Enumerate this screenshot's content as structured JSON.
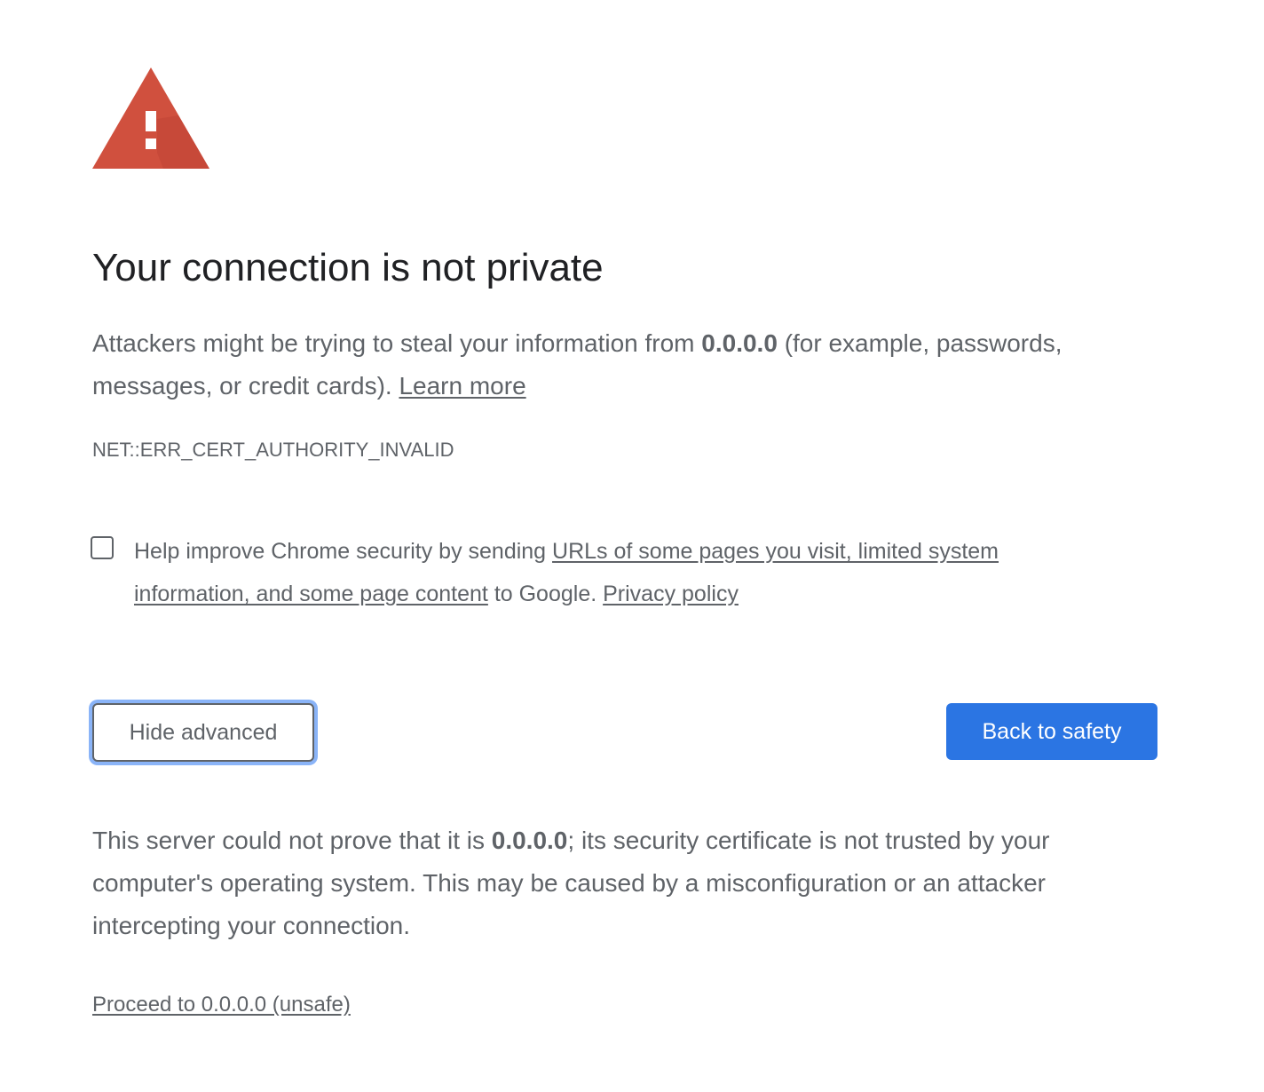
{
  "heading": {
    "title": "Your connection is not private"
  },
  "main_message": {
    "prefix": "Attackers might be trying to steal your information from ",
    "host": "0.0.0.0",
    "suffix": " (for example, passwords, messages, or credit cards). ",
    "learn_more": "Learn more"
  },
  "error_code": "NET::ERR_CERT_AUTHORITY_INVALID",
  "optin": {
    "checked": false,
    "prefix": "Help improve Chrome security by sending ",
    "link": "URLs of some pages you visit, limited system information, and some page content",
    "middle": " to Google. ",
    "privacy_link": "Privacy policy"
  },
  "buttons": {
    "hide_advanced": "Hide advanced",
    "back_to_safety": "Back to safety"
  },
  "details": {
    "prefix": "This server could not prove that it is ",
    "host": "0.0.0.0",
    "suffix": "; its security certificate is not trusted by your computer's operating system. This may be caused by a misconfiguration or an attacker intercepting your connection."
  },
  "proceed_link": "Proceed to 0.0.0.0 (unsafe)",
  "colors": {
    "warning_red": "#d0503e",
    "primary_button": "#2b75e3",
    "focus_ring": "#8ab4f8",
    "text": "#5f6368",
    "title": "#202124"
  },
  "icons": {
    "warning": "warning-triangle-icon"
  }
}
